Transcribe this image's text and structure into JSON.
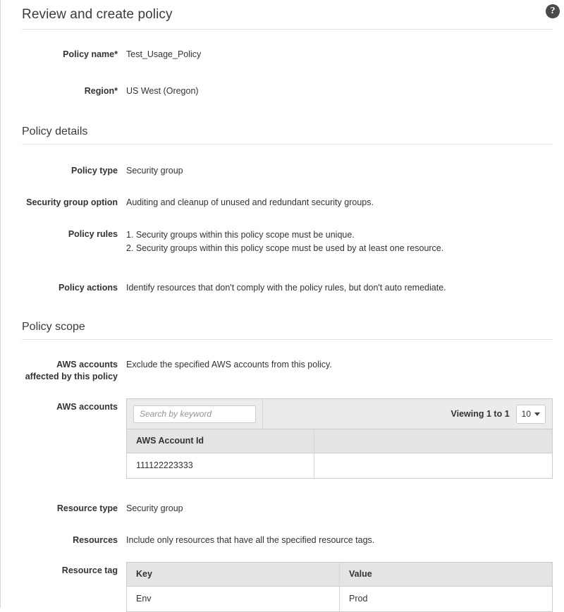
{
  "header": {
    "title": "Review and create policy",
    "help_icon": "help-circle-icon",
    "help_glyph": "?"
  },
  "summary_fields": [
    {
      "label": "Policy name*",
      "value": "Test_Usage_Policy"
    },
    {
      "label": "Region*",
      "value": "US West (Oregon)"
    }
  ],
  "policy_details": {
    "section_title": "Policy details",
    "fields": [
      {
        "label": "Policy type",
        "value": "Security group"
      },
      {
        "label": "Security group option",
        "value": "Auditing and cleanup of unused and redundant security groups."
      }
    ],
    "policy_rules": {
      "label": "Policy rules",
      "rules": [
        "1. Security groups within this policy scope must be unique.",
        "2. Security groups within this policy scope must be used by at least one resource."
      ]
    },
    "policy_actions": {
      "label": "Policy actions",
      "value": "Identify resources that don't comply with the policy rules, but don't auto remediate."
    }
  },
  "policy_scope": {
    "section_title": "Policy scope",
    "accounts_affected": {
      "label_line1": "AWS accounts",
      "label_line2": "affected by this policy",
      "value": "Exclude the specified AWS accounts from this policy."
    },
    "aws_accounts": {
      "label": "AWS accounts",
      "search_placeholder": "Search by keyword",
      "search_value": "",
      "viewing_text": "Viewing 1 to 1",
      "page_size": "10",
      "columns": [
        "AWS Account Id"
      ],
      "rows": [
        [
          "111122223333"
        ]
      ]
    },
    "resource_type": {
      "label": "Resource type",
      "value": "Security group"
    },
    "resources": {
      "label": "Resources",
      "value": "Include only resources that have all the specified resource tags."
    },
    "resource_tag": {
      "label": "Resource tag",
      "columns": [
        "Key",
        "Value"
      ],
      "rows": [
        [
          "Env",
          "Prod"
        ]
      ]
    }
  }
}
